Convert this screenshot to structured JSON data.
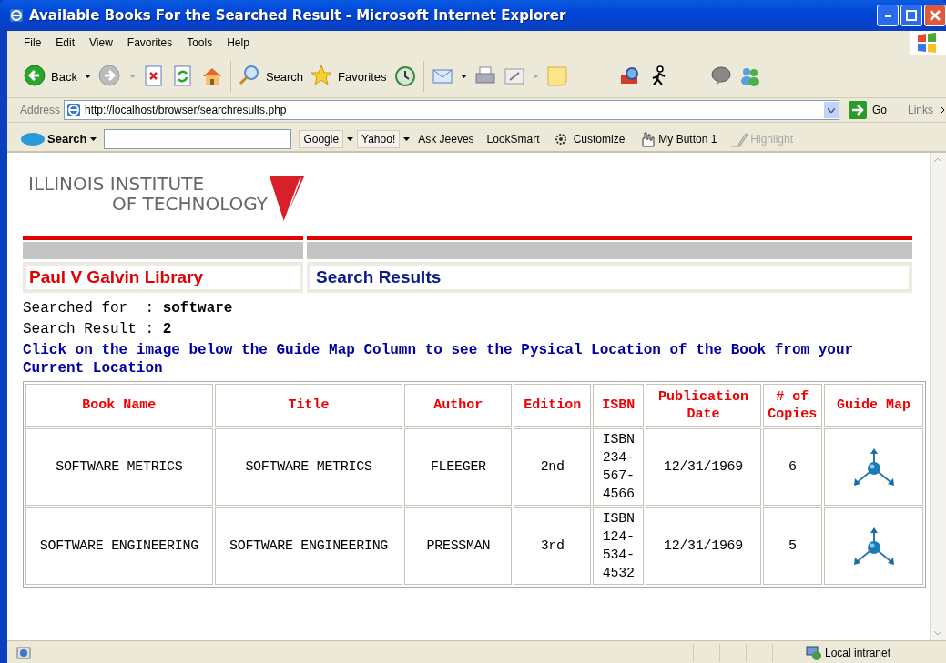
{
  "window": {
    "title": "Available Books For the Searched Result - Microsoft Internet Explorer"
  },
  "menu": [
    "File",
    "Edit",
    "View",
    "Favorites",
    "Tools",
    "Help"
  ],
  "toolbar": {
    "back": "Back",
    "search": "Search",
    "favorites": "Favorites"
  },
  "address_bar": {
    "label": "Address",
    "url": "http://localhost/browser/searchresults.php",
    "go": "Go",
    "links": "Links"
  },
  "search_bar": {
    "brand": "Search",
    "items": [
      {
        "kind": "dropdown",
        "label": "Google",
        "disabled": false
      },
      {
        "kind": "dropdown",
        "label": "Yahoo!",
        "disabled": false
      },
      {
        "kind": "link",
        "label": "Ask Jeeves",
        "disabled": false
      },
      {
        "kind": "link",
        "label": "LookSmart",
        "disabled": false
      },
      {
        "kind": "customize",
        "label": "Customize",
        "disabled": false
      },
      {
        "kind": "mybutton",
        "label": "My Button 1",
        "disabled": false
      },
      {
        "kind": "highlight",
        "label": "Highlight",
        "disabled": true
      }
    ]
  },
  "page": {
    "logo": [
      "ILLINOIS INSTITUTE",
      "OF TECHNOLOGY"
    ],
    "library": "Paul V Galvin Library",
    "heading": "Search Results",
    "searched_for": {
      "label": "Searched for  : ",
      "value": "software"
    },
    "result_count": {
      "label": "Search Result : ",
      "value": "2"
    },
    "instruction": "Click on the image below the Guide Map Column to see the Pysical Location of the Book from your Current Location",
    "table": {
      "columns": [
        "Book Name",
        "Title",
        "Author",
        "Edition",
        "ISBN",
        "Publication Date",
        "# of Copies",
        "Guide Map"
      ],
      "rows": [
        [
          "SOFTWARE METRICS",
          "SOFTWARE METRICS",
          "FLEEGER",
          "2nd",
          "ISBN 234-567-4566",
          "12/31/1969",
          "6"
        ],
        [
          "SOFTWARE ENGINEERING",
          "SOFTWARE ENGINEERING",
          "PRESSMAN",
          "3rd",
          "ISBN 124-534-4532",
          "12/31/1969",
          "5"
        ]
      ]
    }
  },
  "status_bar": {
    "zone": "Local intranet"
  }
}
